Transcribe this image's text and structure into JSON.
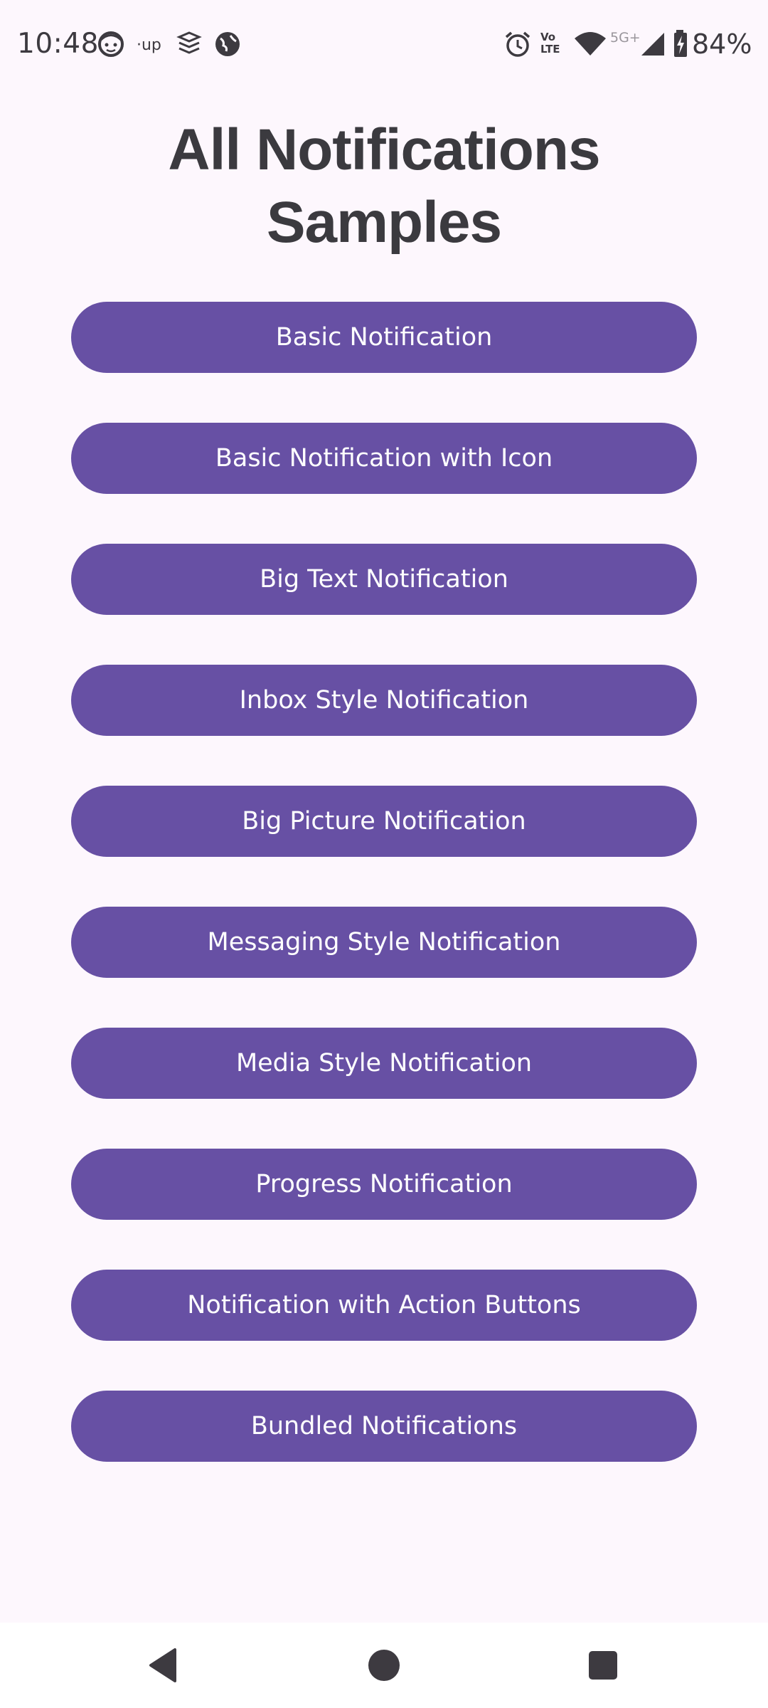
{
  "status_bar": {
    "time": "10:48",
    "left_icons": [
      "face-app-icon",
      "up-app-icon",
      "layers-app-icon",
      "globe-app-icon"
    ],
    "right_icons": [
      "alarm-icon",
      "volte-icon",
      "wifi-icon",
      "5g-icon",
      "signal-icon",
      "battery-charging-icon"
    ],
    "network_label": "5G+",
    "volte_label_top": "Vo",
    "volte_label_bottom": "LTE",
    "battery_percent": "84%"
  },
  "page": {
    "title_line1": "All Notifications",
    "title_line2": "Samples"
  },
  "buttons": [
    {
      "label": "Basic Notification"
    },
    {
      "label": "Basic Notification with Icon"
    },
    {
      "label": "Big Text Notification"
    },
    {
      "label": "Inbox Style Notification"
    },
    {
      "label": "Big Picture Notification"
    },
    {
      "label": "Messaging Style Notification"
    },
    {
      "label": "Media Style Notification"
    },
    {
      "label": "Progress Notification"
    },
    {
      "label": "Notification with Action Buttons"
    },
    {
      "label": "Bundled Notifications"
    }
  ],
  "nav_bar": {
    "back": "back-icon",
    "home": "home-icon",
    "recents": "recents-icon"
  },
  "colors": {
    "background": "#fdf7fd",
    "button": "#6750a4",
    "button_text": "#ffffff",
    "title_text": "#3b3a3f"
  }
}
